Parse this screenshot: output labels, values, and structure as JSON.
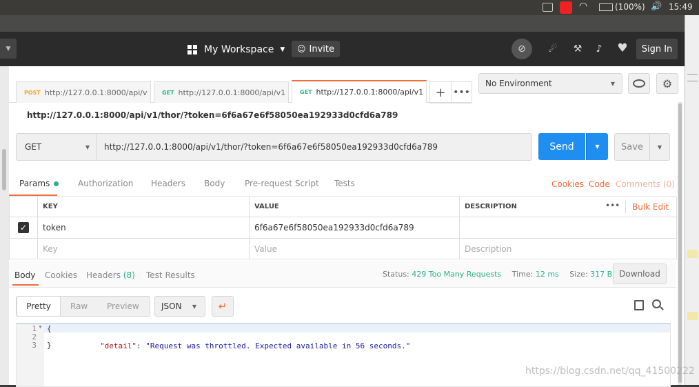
{
  "os": {
    "battery": "(100%)",
    "time": "15:49"
  },
  "header": {
    "workspace": "My Workspace",
    "invite": "Invite",
    "signin": "Sign In"
  },
  "tabs": [
    {
      "method": "POST",
      "url": "http://127.0.0.1:8000/api/v",
      "method_color": "#f5a623"
    },
    {
      "method": "GET",
      "url": "http://127.0.0.1:8000/api/v1",
      "method_color": "#26b47f"
    },
    {
      "method": "GET",
      "url": "http://127.0.0.1:8000/api/v1",
      "method_color": "#26b47f"
    }
  ],
  "environment": {
    "selected": "No Environment"
  },
  "request": {
    "title": "http://127.0.0.1:8000/api/v1/thor/?token=6f6a67e6f58050ea192933d0cfd6a789",
    "method": "GET",
    "url": "http://127.0.0.1:8000/api/v1/thor/?token=6f6a67e6f58050ea192933d0cfd6a789",
    "send": "Send",
    "save": "Save"
  },
  "req_tabs": {
    "params": "Params",
    "authorization": "Authorization",
    "headers": "Headers",
    "body": "Body",
    "prerequest": "Pre-request Script",
    "tests": "Tests",
    "cookies": "Cookies",
    "code": "Code",
    "comments": "Comments (0)"
  },
  "params_table": {
    "columns": {
      "key": "KEY",
      "value": "VALUE",
      "description": "DESCRIPTION"
    },
    "bulk_edit": "Bulk Edit",
    "rows": [
      {
        "key": "token",
        "value": "6f6a67e6f58050ea192933d0cfd6a789",
        "description": ""
      }
    ],
    "placeholders": {
      "key": "Key",
      "value": "Value",
      "description": "Description"
    }
  },
  "response": {
    "tabs": {
      "body": "Body",
      "cookies": "Cookies",
      "headers": "Headers",
      "headers_count": "(8)",
      "test_results": "Test Results"
    },
    "status_label": "Status:",
    "status_value": "429 Too Many Requests",
    "time_label": "Time:",
    "time_value": "12 ms",
    "size_label": "Size:",
    "size_value": "317 B",
    "download": "Download",
    "views": {
      "pretty": "Pretty",
      "raw": "Raw",
      "preview": "Preview"
    },
    "format": "JSON",
    "code_lines": [
      {
        "num": "1",
        "text": "{"
      },
      {
        "num": "2",
        "key": "\"detail\"",
        "colon": ": ",
        "value": "\"Request was throttled. Expected available in 56 seconds.\""
      },
      {
        "num": "3",
        "text": "}"
      }
    ]
  },
  "watermark": "https://blog.csdn.net/qq_41500222",
  "colors": {
    "accent": "#f26b3a",
    "send": "#1f8ef1",
    "status_ok": "#26b47f"
  }
}
